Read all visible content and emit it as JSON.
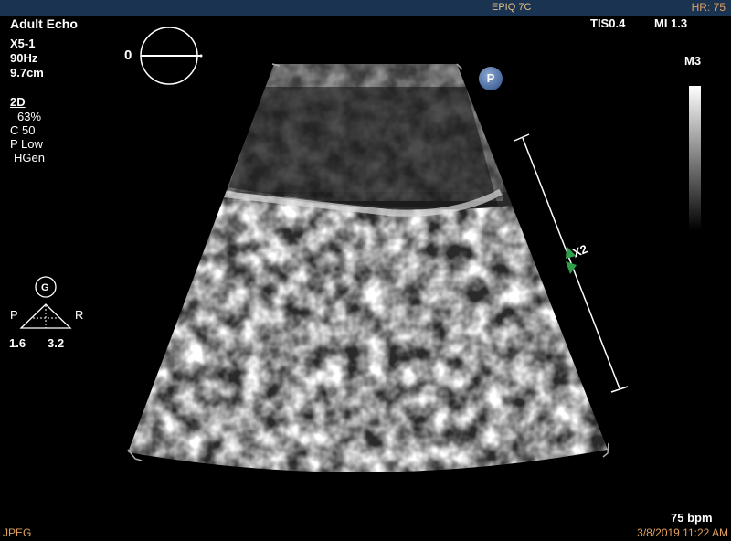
{
  "top_bar": {
    "product": "EPIQ 7C",
    "heart_rate": "HR: 75"
  },
  "preset": "Adult Echo",
  "transducer": {
    "probe": "X5-1",
    "frame_rate": "90Hz",
    "depth": "9.7cm"
  },
  "mode_2d": {
    "title": "2D",
    "gain": "63%",
    "compression": "C 50",
    "power": "P Low",
    "frequency": "HGen"
  },
  "rotation": {
    "angle": "0"
  },
  "safety": {
    "tis": "TIS0.4",
    "mi": "MI 1.3"
  },
  "map": {
    "label": "M3"
  },
  "xplane": {
    "label": "X2"
  },
  "orientation": {
    "g_label": "G",
    "p_label": "P",
    "r_label": "R",
    "left_value": "1.6",
    "right_value": "3.2"
  },
  "footer": {
    "bpm": "75 bpm",
    "format": "JPEG",
    "datetime": "3/8/2019 11:22 AM"
  },
  "colors": {
    "top_bar": "#1a3350",
    "accent_orange": "#e0a060",
    "caliper_green": "#2fa04a"
  },
  "icons": {
    "logo": "philips-p-icon"
  }
}
